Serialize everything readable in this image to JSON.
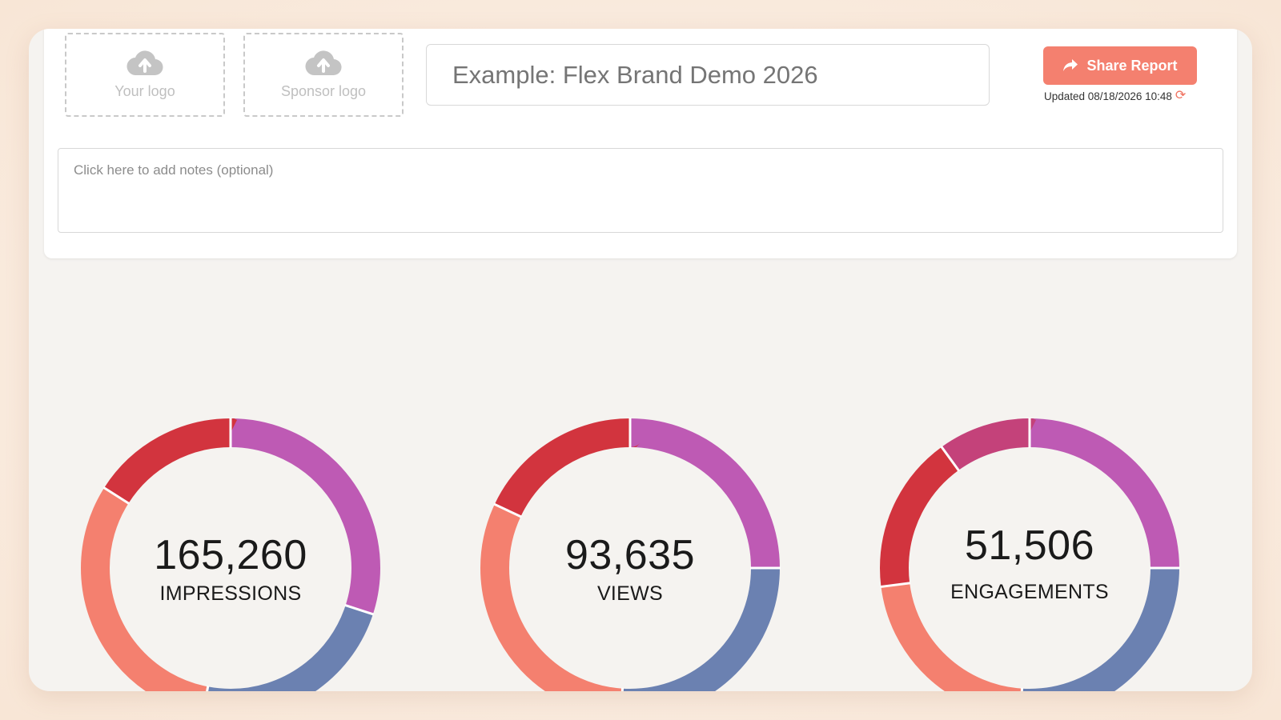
{
  "logos": {
    "your_logo_label": "Your logo",
    "sponsor_logo_label": "Sponsor logo"
  },
  "report": {
    "title_placeholder": "Example: Flex Brand Demo 2026",
    "share_label": "Share Report",
    "updated_text": "Updated 08/18/2026 10:48",
    "notes_placeholder": "Click here to add notes (optional)"
  },
  "colors": {
    "purple": "#be5ab4",
    "blue": "#6b81b1",
    "salmon": "#f4806f",
    "red": "#d2343e",
    "magenta": "#c4427a",
    "accent": "#f4806f"
  },
  "metrics": [
    {
      "value": "165,260",
      "label": "IMPRESSIONS",
      "segments": [
        {
          "color": "#be5ab4",
          "fraction": 0.3
        },
        {
          "color": "#6b81b1",
          "fraction": 0.23
        },
        {
          "color": "#f4806f",
          "fraction": 0.31
        },
        {
          "color": "#d2343e",
          "fraction": 0.16
        }
      ]
    },
    {
      "value": "93,635",
      "label": "VIEWS",
      "segments": [
        {
          "color": "#be5ab4",
          "fraction": 0.25
        },
        {
          "color": "#6b81b1",
          "fraction": 0.26
        },
        {
          "color": "#f4806f",
          "fraction": 0.31
        },
        {
          "color": "#d2343e",
          "fraction": 0.18
        }
      ]
    },
    {
      "value": "51,506",
      "label": "ENGAGEMENTS",
      "segments": [
        {
          "color": "#be5ab4",
          "fraction": 0.25
        },
        {
          "color": "#6b81b1",
          "fraction": 0.26
        },
        {
          "color": "#f4806f",
          "fraction": 0.22
        },
        {
          "color": "#d2343e",
          "fraction": 0.17
        },
        {
          "color": "#c4427a",
          "fraction": 0.1
        }
      ]
    }
  ]
}
